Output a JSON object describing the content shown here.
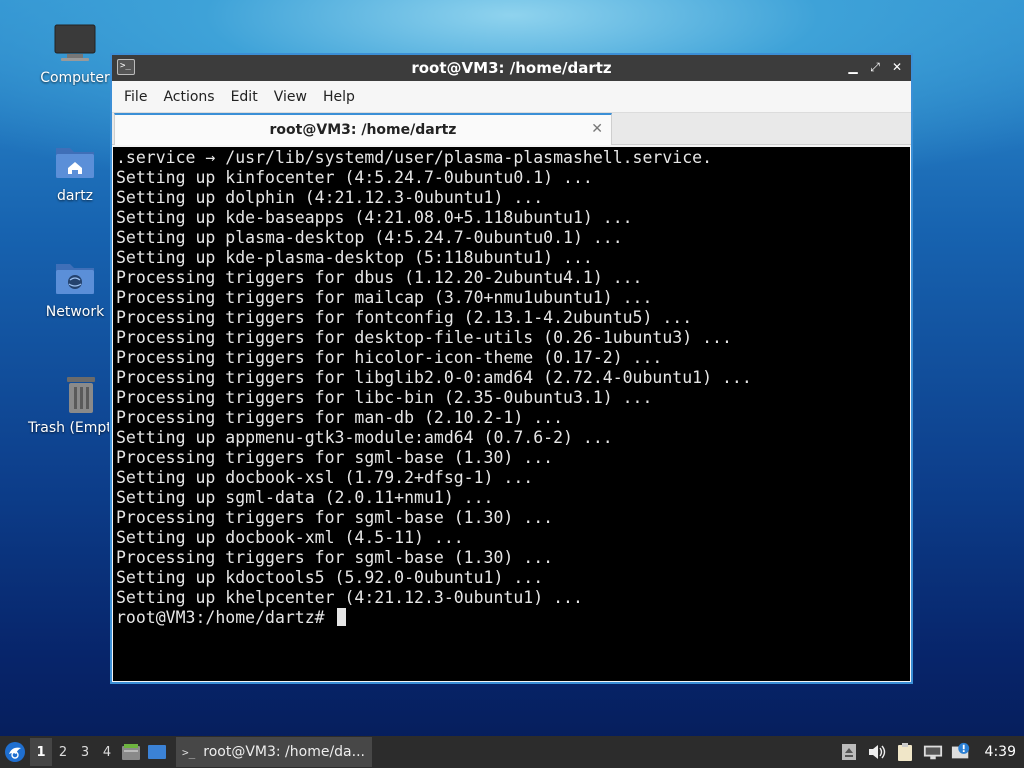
{
  "desktop": {
    "icons": [
      {
        "label": "Computer",
        "icon": "monitor-icon"
      },
      {
        "label": "dartz",
        "icon": "home-folder-icon"
      },
      {
        "label": "Network",
        "icon": "network-folder-icon"
      },
      {
        "label": "Trash (Empty)",
        "icon": "trash-icon"
      }
    ]
  },
  "window": {
    "title": "root@VM3: /home/dartz",
    "controls": {
      "minimize": "▁",
      "maximize": "⤢",
      "close": "✕"
    },
    "menu": [
      "File",
      "Actions",
      "Edit",
      "View",
      "Help"
    ],
    "tab": {
      "label": "root@VM3: /home/dartz",
      "close": "✕"
    }
  },
  "terminal": {
    "lines": [
      ".service → /usr/lib/systemd/user/plasma-plasmashell.service.",
      "Setting up kinfocenter (4:5.24.7-0ubuntu0.1) ...",
      "Setting up dolphin (4:21.12.3-0ubuntu1) ...",
      "Setting up kde-baseapps (4:21.08.0+5.118ubuntu1) ...",
      "Setting up plasma-desktop (4:5.24.7-0ubuntu0.1) ...",
      "Setting up kde-plasma-desktop (5:118ubuntu1) ...",
      "Processing triggers for dbus (1.12.20-2ubuntu4.1) ...",
      "Processing triggers for mailcap (3.70+nmu1ubuntu1) ...",
      "Processing triggers for fontconfig (2.13.1-4.2ubuntu5) ...",
      "Processing triggers for desktop-file-utils (0.26-1ubuntu3) ...",
      "Processing triggers for hicolor-icon-theme (0.17-2) ...",
      "Processing triggers for libglib2.0-0:amd64 (2.72.4-0ubuntu1) ...",
      "Processing triggers for libc-bin (2.35-0ubuntu3.1) ...",
      "Processing triggers for man-db (2.10.2-1) ...",
      "Setting up appmenu-gtk3-module:amd64 (0.7.6-2) ...",
      "Processing triggers for sgml-base (1.30) ...",
      "Setting up docbook-xsl (1.79.2+dfsg-1) ...",
      "Setting up sgml-data (2.0.11+nmu1) ...",
      "Processing triggers for sgml-base (1.30) ...",
      "Setting up docbook-xml (4.5-11) ...",
      "Processing triggers for sgml-base (1.30) ...",
      "Setting up kdoctools5 (5.92.0-0ubuntu1) ...",
      "Setting up khelpcenter (4:21.12.3-0ubuntu1) ..."
    ],
    "prompt": "root@VM3:/home/dartz# "
  },
  "taskbar": {
    "workspaces": [
      "1",
      "2",
      "3",
      "4"
    ],
    "active_workspace": "1",
    "task_label": "root@VM3: /home/da...",
    "task_icon_text": ">_",
    "clock": "4:39"
  }
}
